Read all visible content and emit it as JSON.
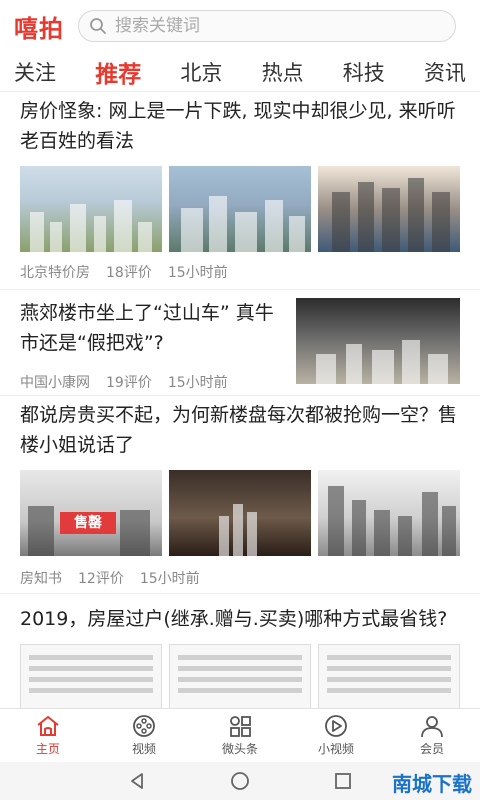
{
  "header": {
    "logo": "嘻拍",
    "search_placeholder": "搜索关键词"
  },
  "tabs": [
    "关注",
    "推荐",
    "北京",
    "热点",
    "科技",
    "资讯"
  ],
  "active_tab": 1,
  "articles": [
    {
      "title": "房价怪象: 网上是一片下跌, 现实中却很少见, 来听听老百姓的看法",
      "source": "北京特价房",
      "comments": "18评价",
      "time": "15小时前"
    },
    {
      "title": "燕郊楼市坐上了“过山车” 真牛市还是“假把戏”?",
      "source": "中国小康网",
      "comments": "19评价",
      "time": "15小时前"
    },
    {
      "title": "都说房贵买不起，为何新楼盘每次都被抢购一空？售楼小姐说话了",
      "source": "房知书",
      "comments": "12评价",
      "time": "15小时前",
      "sign_text": "售罄"
    },
    {
      "title": "2019，房屋过户(继承.赠与.买卖)哪种方式最省钱?"
    }
  ],
  "bottom_nav": [
    {
      "label": "主页",
      "icon": "home-icon"
    },
    {
      "label": "视频",
      "icon": "film-reel-icon"
    },
    {
      "label": "微头条",
      "icon": "grid-icon"
    },
    {
      "label": "小视频",
      "icon": "play-circle-icon"
    },
    {
      "label": "会员",
      "icon": "user-icon"
    }
  ],
  "colors": {
    "accent": "#e6392f"
  },
  "watermark": "南城下载"
}
